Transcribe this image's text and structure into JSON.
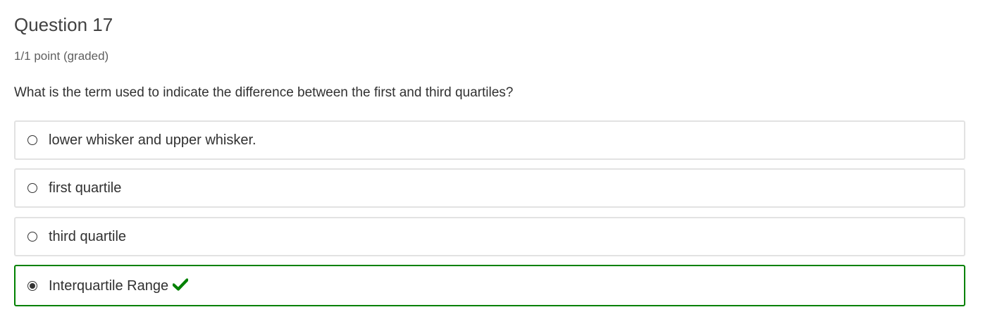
{
  "question": {
    "title": "Question 17",
    "score": "1/1 point (graded)",
    "prompt": "What is the term used to indicate the difference between the first and third quartiles?"
  },
  "choices": [
    {
      "label": "lower whisker and upper whisker.",
      "selected": false
    },
    {
      "label": "first quartile",
      "selected": false
    },
    {
      "label": "third quartile",
      "selected": false
    },
    {
      "label": "Interquartile Range",
      "selected": true,
      "status": "correct"
    }
  ],
  "colors": {
    "correct": "#008100",
    "border": "#e2e2e2",
    "text": "#313131"
  },
  "icons": {
    "correct": "checkmark-icon"
  }
}
